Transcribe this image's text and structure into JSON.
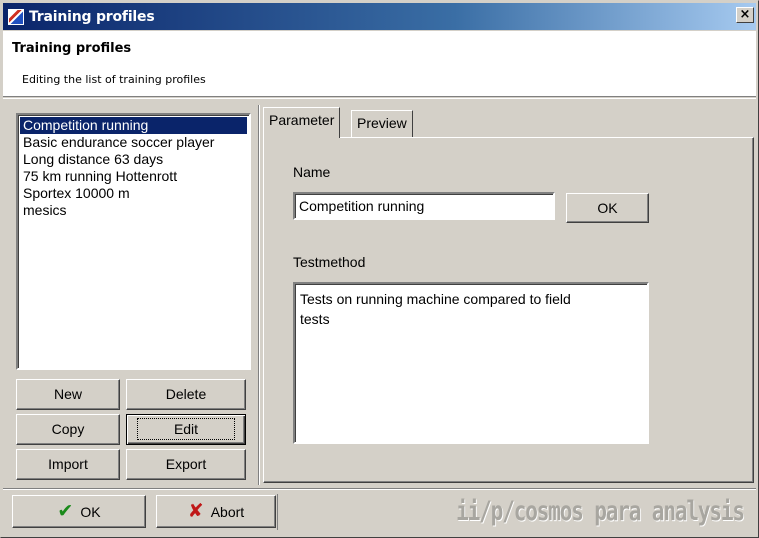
{
  "window": {
    "title": "Training profiles",
    "close_label": "×"
  },
  "header": {
    "title": "Training profiles",
    "subtitle": "Editing the list of training profiles"
  },
  "profiles": {
    "items": [
      "Competition running",
      "Basic endurance soccer player",
      "Long distance 63 days",
      "75 km running Hottenrott",
      "Sportex 10000 m",
      "mesics"
    ],
    "selected_index": 0
  },
  "list_buttons": {
    "new": "New",
    "delete": "Delete",
    "copy": "Copy",
    "edit": "Edit",
    "import": "Import",
    "export": "Export"
  },
  "tabs": [
    {
      "label": "Parameter",
      "active": true
    },
    {
      "label": "Preview",
      "active": false
    }
  ],
  "parameter": {
    "name_label": "Name",
    "name_value": "Competition running",
    "ok_label": "OK",
    "testmethod_label": "Testmethod",
    "testmethod_value": "Tests on running machine compared to field\ntests"
  },
  "footer": {
    "ok_label": "OK",
    "abort_label": "Abort",
    "brand": "ii/p/cosmos para analysis"
  },
  "colors": {
    "selection": "#0a246a",
    "face": "#d4d0c8",
    "ok_icon": "#1a8a1a",
    "abort_icon": "#c01818"
  },
  "icons": {
    "ok": "check-icon",
    "abort": "x-icon",
    "close": "close-icon"
  }
}
